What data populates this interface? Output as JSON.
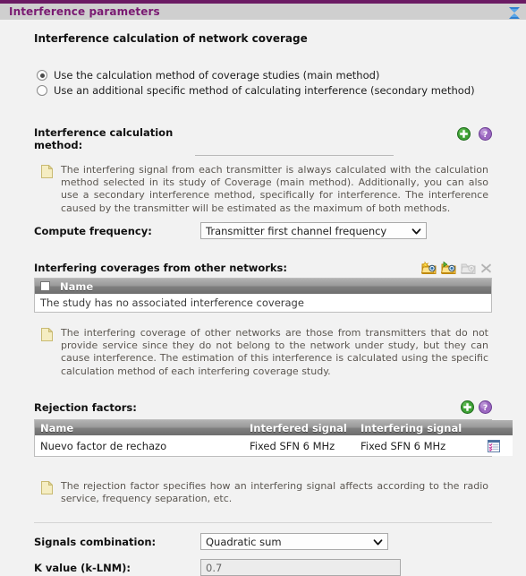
{
  "panel": {
    "title": "Interference parameters",
    "collapse_icon": "collapse-chevrons-icon"
  },
  "coverage_section": {
    "heading": "Interference calculation of network coverage",
    "options": [
      {
        "label": "Use the calculation method of coverage studies (main method)",
        "selected": true
      },
      {
        "label": "Use an additional specific method of calculating interference (secondary method)",
        "selected": false
      }
    ]
  },
  "method_field": {
    "label_line1": "Interference calculation",
    "label_line2": "method:",
    "value": "",
    "placeholder": "",
    "add_icon": "add-green-plus-icon",
    "help_icon": "help-question-icon"
  },
  "method_note": {
    "icon": "note-page-icon",
    "text": "The interfering signal from each transmitter is always calculated with the calculation method selected in its study of Coverage (main method). Additionally, you can also use a secondary interference method, specifically for interference. The interference caused by the transmitter will be estimated as the maximum of both methods."
  },
  "compute_frequency": {
    "label": "Compute frequency:",
    "value": "Transmitter first channel frequency",
    "options": [
      "Transmitter first channel frequency"
    ]
  },
  "interfering_coverages": {
    "label": "Interfering coverages from other networks:",
    "toolbar": [
      {
        "name": "add-coverage-folder-icon",
        "enabled": true
      },
      {
        "name": "import-coverage-folder-icon",
        "enabled": true
      },
      {
        "name": "open-coverage-folder-icon",
        "enabled": false
      },
      {
        "name": "delete-coverage-x-icon",
        "enabled": false
      }
    ],
    "columns": [
      "Name"
    ],
    "rows": [],
    "empty_message": "The study has no associated interference coverage"
  },
  "coverages_note": {
    "icon": "note-page-icon",
    "text": "The interfering coverage of other networks are those from transmitters that do not provide service since they do not belong to the network under study, but they can cause interference. The estimation of this interference is calculated using the specific calculation method of each interfering coverage study."
  },
  "rejection_factors": {
    "label": "Rejection factors:",
    "add_icon": "add-green-plus-icon",
    "help_icon": "help-question-icon",
    "columns": [
      "Name",
      "Interfered signal",
      "Interfering signal",
      ""
    ],
    "rows": [
      {
        "name": "Nuevo factor de rechazo",
        "interfered_signal": "Fixed SFN 6 MHz",
        "interfering_signal": "Fixed SFN 6 MHz",
        "action_icon": "edit-properties-list-icon"
      }
    ]
  },
  "rejection_note": {
    "icon": "note-page-icon",
    "text": "The rejection factor specifies how an interfering signal affects according to the radio service, frequency separation, etc."
  },
  "signals_combination": {
    "label": "Signals combination:",
    "value": "Quadratic sum",
    "options": [
      "Quadratic sum"
    ]
  },
  "k_value": {
    "label": "K value (k-LNM):",
    "value": "0.7"
  },
  "colors": {
    "title_purple": "#7a1a72",
    "header_stripe": "#6b1a63",
    "header_bg": "#cfcfcf",
    "body_bg": "#f2f2f2",
    "note_text": "#5b5650",
    "accent_green": "#3ea135",
    "accent_help": "#9b67c0"
  }
}
